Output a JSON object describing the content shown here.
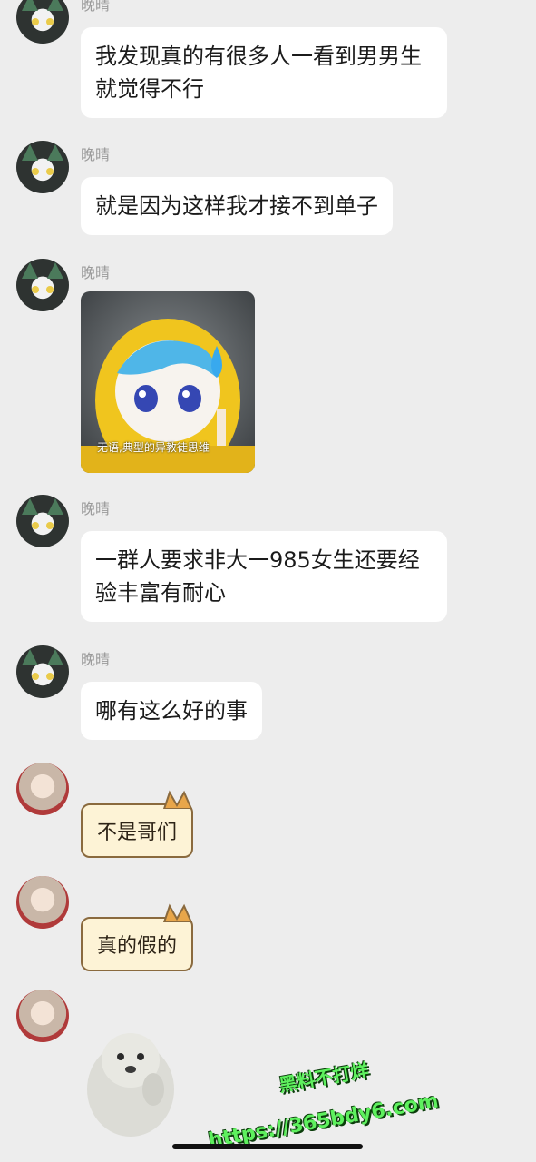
{
  "messages": [
    {
      "sender": "晚晴",
      "type": "text",
      "lines": [
        "我发现真的有很多人一看到男男生",
        "就觉得不行"
      ]
    },
    {
      "sender": "晚晴",
      "type": "text",
      "lines": [
        "就是因为这样我才接不到单子"
      ]
    },
    {
      "sender": "晚晴",
      "type": "sticker",
      "caption": "无语,典型的异教徒思维"
    },
    {
      "sender": "晚晴",
      "type": "text",
      "lines": [
        "一群人要求非大一985女生还要经",
        "验丰富有耐心"
      ]
    },
    {
      "sender": "晚晴",
      "type": "text",
      "lines": [
        "哪有这么好的事"
      ]
    },
    {
      "sender": "",
      "type": "cat-bubble",
      "text": "不是哥们"
    },
    {
      "sender": "",
      "type": "cat-bubble",
      "text": "真的假的"
    },
    {
      "sender": "",
      "type": "sticker",
      "caption": ""
    }
  ],
  "watermark": {
    "line1": "黑料不打烊",
    "line2": "https://365bdy6.com"
  },
  "colors": {
    "background": "#ededed",
    "bubble": "#ffffff",
    "cat_bubble": "#fdf3d6",
    "watermark": "#5ef05e"
  }
}
